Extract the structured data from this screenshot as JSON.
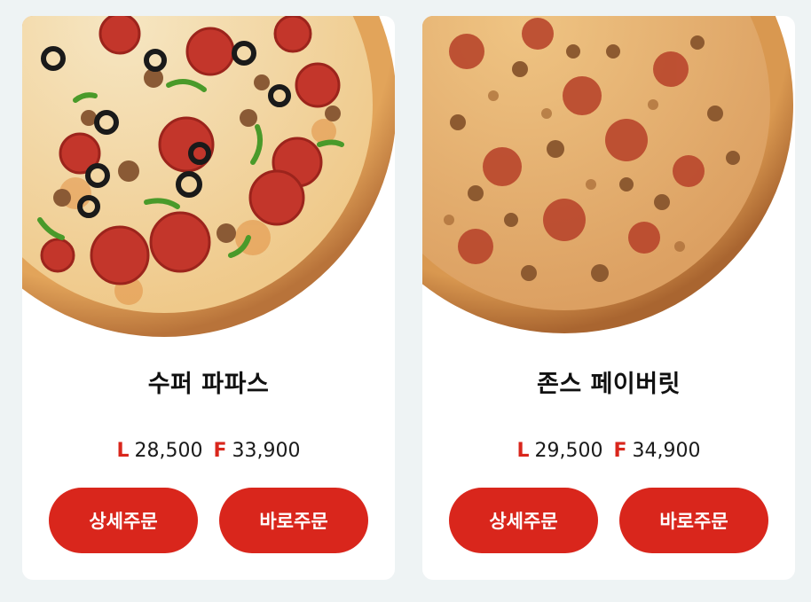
{
  "products": [
    {
      "name": "수퍼 파파스",
      "price_l_label": "L",
      "price_l": "28,500",
      "price_f_label": "F",
      "price_f": "33,900",
      "detail_button": "상세주문",
      "quick_button": "바로주문"
    },
    {
      "name": "존스 페이버릿",
      "price_l_label": "L",
      "price_l": "29,500",
      "price_f_label": "F",
      "price_f": "34,900",
      "detail_button": "상세주문",
      "quick_button": "바로주문"
    }
  ],
  "colors": {
    "accent": "#d9261c",
    "background": "#eef3f4",
    "card": "#ffffff"
  }
}
